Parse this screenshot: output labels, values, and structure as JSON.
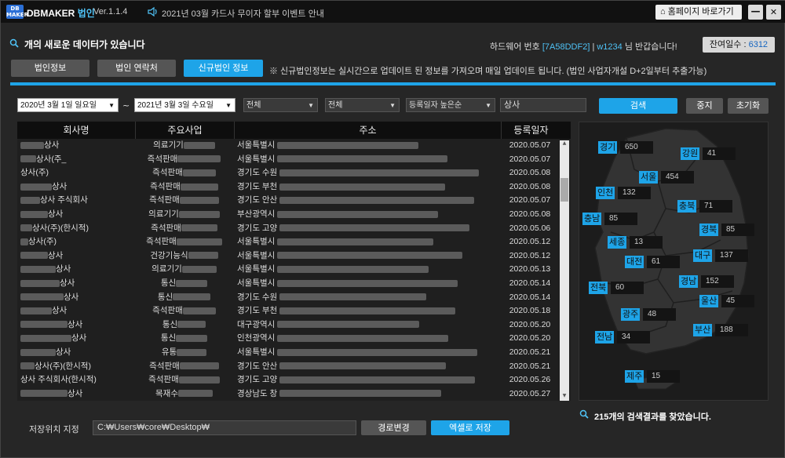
{
  "titlebar": {
    "logo_top": "DB",
    "logo_bottom": "MAKER",
    "app_name": "DBMAKER",
    "app_corp": "법인",
    "version": "Ver.1.1.4",
    "notice": "2021년 03월 카드사 무이자 할부 이벤트 안내",
    "home_button": "홈페이지 바로가기",
    "minimize": "—",
    "close": "✕"
  },
  "info": {
    "new_data": "개의 새로운 데이터가 있습니다",
    "hw_label": "하드웨어 번호",
    "hw_id": "[7A58DDF2]",
    "sep": "|",
    "user": "w1234",
    "greeting": "님 반갑습니다!",
    "remain_label": "잔여일수 :",
    "remain_value": "6312"
  },
  "tabs": [
    {
      "label": "법인정보"
    },
    {
      "label": "법인 연락처"
    },
    {
      "label": "신규법인 정보"
    }
  ],
  "tab_note": "※ 신규법인정보는 실시간으로 업데이트 된 정보를 가져오며 매일 업데이트 됩니다. (법인 사업자개설 D+2일부터 추출가능)",
  "filters": {
    "date_from": "2020년  3월  1일 일요일",
    "tilde": "~",
    "date_to": "2021년  3월  3일 수요일",
    "region1": "전체",
    "region2": "전체",
    "sort": "등록일자 높은순",
    "keyword": "상사",
    "search": "검색",
    "stop": "중지",
    "reset": "초기화"
  },
  "table": {
    "headers": [
      "회사명",
      "주요사업",
      "주소",
      "등록일자"
    ],
    "rows": [
      {
        "name": "상사",
        "biz": "의료기기",
        "addr": "서울특별시",
        "date": "2020.05.07"
      },
      {
        "name": "상사(주_",
        "biz": "즉석판매",
        "addr": "서울특별시",
        "date": "2020.05.07"
      },
      {
        "name": "상사(주)",
        "biz": "즉석판매",
        "addr": "경기도 수원",
        "date": "2020.05.08"
      },
      {
        "name": "상사",
        "biz": "즉석판매",
        "addr": "경기도 부천",
        "date": "2020.05.08"
      },
      {
        "name": "상사 주식회사",
        "biz": "즉석판매",
        "addr": "경기도 안산",
        "date": "2020.05.07"
      },
      {
        "name": "상사",
        "biz": "의료기기",
        "addr": "부산광역시",
        "date": "2020.05.08"
      },
      {
        "name": "상사(주)(한시적)",
        "biz": "즉석판매",
        "addr": "경기도 고양",
        "date": "2020.05.06"
      },
      {
        "name": "상사(주)",
        "biz": "즉석판매",
        "addr": "서울특별시",
        "date": "2020.05.12"
      },
      {
        "name": "상사",
        "biz": "건강기능식",
        "addr": "서울특별시",
        "date": "2020.05.12"
      },
      {
        "name": "상사",
        "biz": "의료기기",
        "addr": "서울특별시",
        "date": "2020.05.13"
      },
      {
        "name": "상사",
        "biz": "통신",
        "addr": "서울특별시",
        "date": "2020.05.14"
      },
      {
        "name": "상사",
        "biz": "통신",
        "addr": "경기도 수원",
        "date": "2020.05.14"
      },
      {
        "name": "상사",
        "biz": "즉석판매",
        "addr": "경기도 부천",
        "date": "2020.05.18"
      },
      {
        "name": "상사",
        "biz": "통신",
        "addr": "대구광역시",
        "date": "2020.05.20"
      },
      {
        "name": "상사",
        "biz": "통신",
        "addr": "인천광역시",
        "date": "2020.05.20"
      },
      {
        "name": "상사",
        "biz": "유통",
        "addr": "서울특별시",
        "date": "2020.05.21"
      },
      {
        "name": "상사(주)(한시적)",
        "biz": "즉석판매",
        "addr": "경기도 안산",
        "date": "2020.05.21"
      },
      {
        "name": "상사 주식회사(한시적)",
        "biz": "즉석판매",
        "addr": "경기도 고양",
        "date": "2020.05.26"
      },
      {
        "name": "상사",
        "biz": "목재수",
        "addr": "경상남도 창",
        "date": "2020.05.27"
      }
    ]
  },
  "map": {
    "regions": [
      {
        "name": "경기",
        "count": "650"
      },
      {
        "name": "강원",
        "count": "41"
      },
      {
        "name": "서울",
        "count": "454"
      },
      {
        "name": "인천",
        "count": "132"
      },
      {
        "name": "충북",
        "count": "71"
      },
      {
        "name": "충남",
        "count": "85"
      },
      {
        "name": "경북",
        "count": "85"
      },
      {
        "name": "세종",
        "count": "13"
      },
      {
        "name": "대구",
        "count": "137"
      },
      {
        "name": "대전",
        "count": "61"
      },
      {
        "name": "경남",
        "count": "152"
      },
      {
        "name": "전북",
        "count": "60"
      },
      {
        "name": "울산",
        "count": "45"
      },
      {
        "name": "광주",
        "count": "48"
      },
      {
        "name": "부산",
        "count": "188"
      },
      {
        "name": "전남",
        "count": "34"
      },
      {
        "name": "제주",
        "count": "15"
      }
    ],
    "result_note": "215개의 검색결과를 찾았습니다."
  },
  "bottom": {
    "save_label": "저장위치 지정",
    "path": "C:₩Users₩core₩Desktop₩",
    "change_path": "경로변경",
    "save_excel": "엑셀로 저장"
  },
  "colors": {
    "accent": "#1ea4e8",
    "background": "#262626"
  }
}
